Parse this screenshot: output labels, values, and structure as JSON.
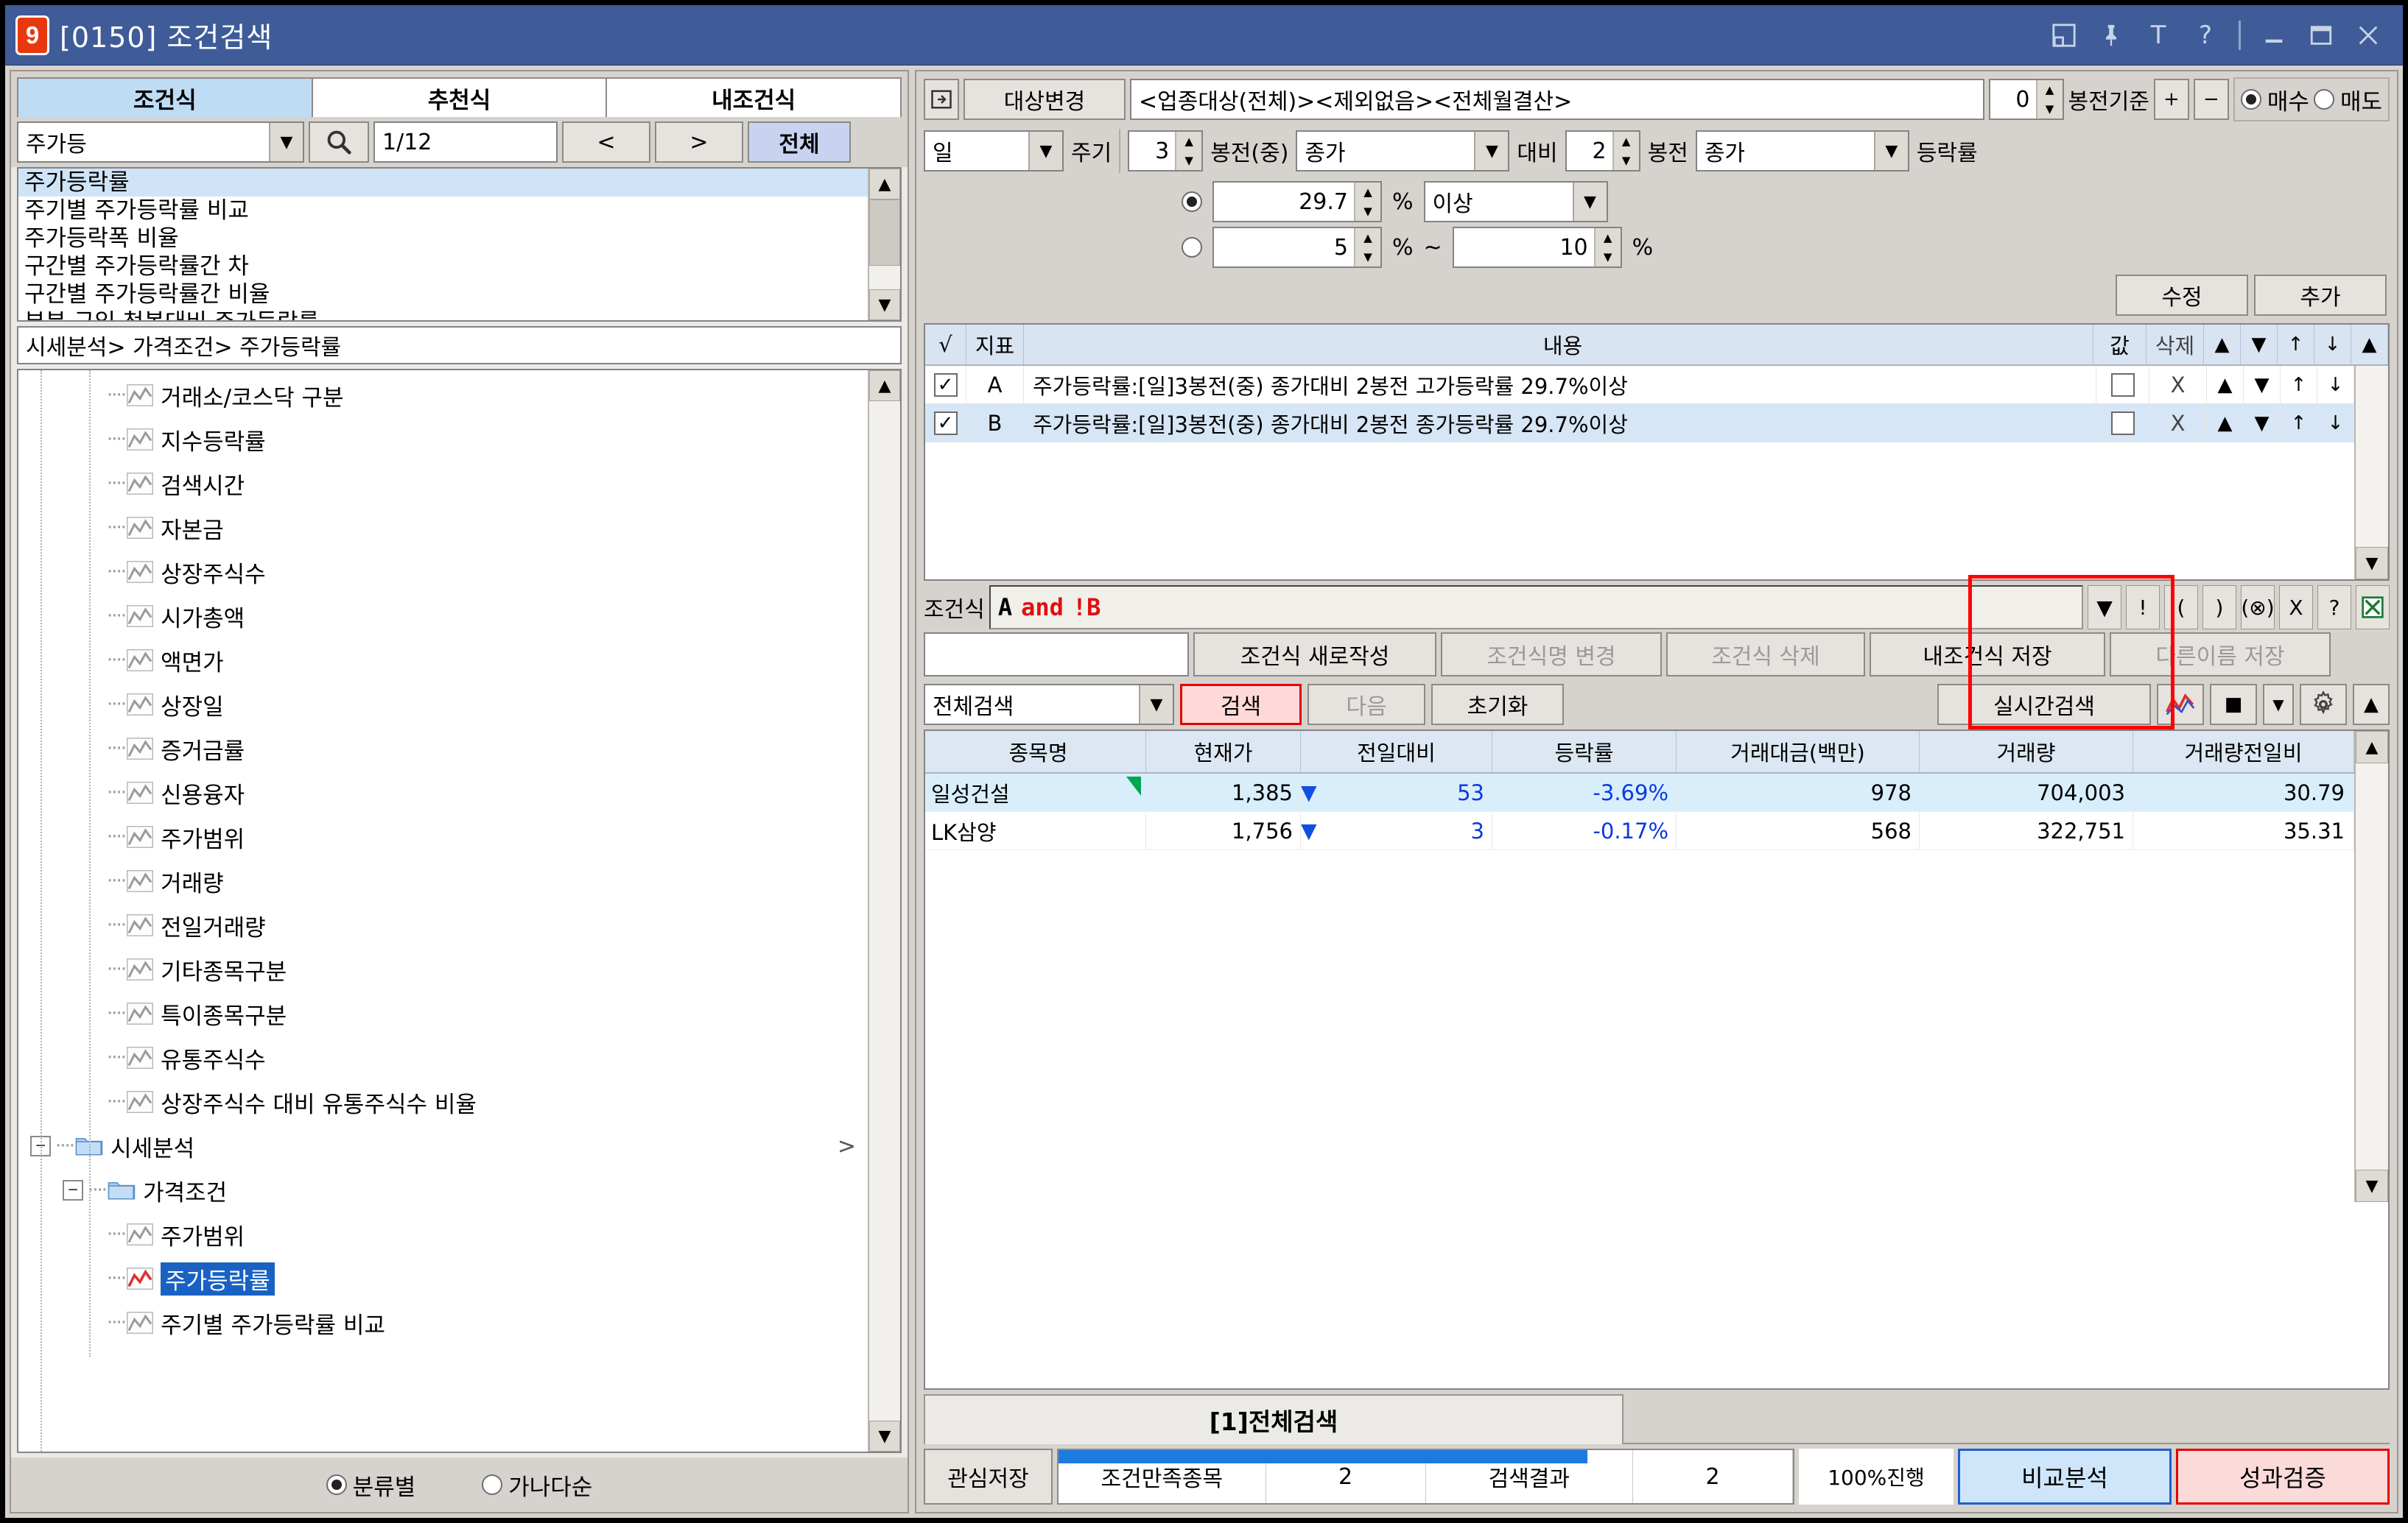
{
  "window": {
    "badge": "9",
    "title": "[0150] 조건검색",
    "icons": [
      "restore-icon",
      "pin-icon",
      "text-icon",
      "help-icon",
      "minimize-icon",
      "maximize-icon",
      "close-icon"
    ]
  },
  "left": {
    "tabs": [
      {
        "label": "조건식",
        "active": true
      },
      {
        "label": "추천식",
        "active": false
      },
      {
        "label": "내조건식",
        "active": false
      }
    ],
    "search": {
      "category": "주가등",
      "search_icon": "magnifier-icon",
      "page": "1/12",
      "prev": "<",
      "next": ">",
      "all": "전체"
    },
    "list": [
      {
        "label": "주가등락률",
        "selected": true
      },
      {
        "label": "주기별 주가등락률 비교",
        "selected": false
      },
      {
        "label": "주가등락폭 비율",
        "selected": false
      },
      {
        "label": "구간별 주가등락률간 차",
        "selected": false
      },
      {
        "label": "구간별 주가등락률간 비율",
        "selected": false
      },
      {
        "label": "부분 구입 첫봉대비 주가등락률",
        "selected": false
      }
    ],
    "breadcrumb": "시세분석> 가격조건> 주가등락률",
    "tree": [
      {
        "label": "거래소/코스닥 구분",
        "type": "leaf",
        "depth": 2
      },
      {
        "label": "지수등락률",
        "type": "leaf",
        "depth": 2
      },
      {
        "label": "검색시간",
        "type": "leaf",
        "depth": 2
      },
      {
        "label": "자본금",
        "type": "leaf",
        "depth": 2
      },
      {
        "label": "상장주식수",
        "type": "leaf",
        "depth": 2
      },
      {
        "label": "시가총액",
        "type": "leaf",
        "depth": 2
      },
      {
        "label": "액면가",
        "type": "leaf",
        "depth": 2
      },
      {
        "label": "상장일",
        "type": "leaf",
        "depth": 2
      },
      {
        "label": "증거금률",
        "type": "leaf",
        "depth": 2
      },
      {
        "label": "신용융자",
        "type": "leaf",
        "depth": 2
      },
      {
        "label": "주가범위",
        "type": "leaf",
        "depth": 2
      },
      {
        "label": "거래량",
        "type": "leaf",
        "depth": 2
      },
      {
        "label": "전일거래량",
        "type": "leaf",
        "depth": 2
      },
      {
        "label": "기타종목구분",
        "type": "leaf",
        "depth": 2
      },
      {
        "label": "특이종목구분",
        "type": "leaf",
        "depth": 2
      },
      {
        "label": "유통주식수",
        "type": "leaf",
        "depth": 2
      },
      {
        "label": "상장주식수 대비 유통주식수 비율",
        "type": "leaf",
        "depth": 2
      },
      {
        "label": "시세분석",
        "type": "folder",
        "depth": 0,
        "expander": "−",
        "chevron": ">"
      },
      {
        "label": "가격조건",
        "type": "folder",
        "depth": 1,
        "expander": "−"
      },
      {
        "label": "주가범위",
        "type": "leaf",
        "depth": 2
      },
      {
        "label": "주가등락률",
        "type": "leaf-sel",
        "depth": 2
      },
      {
        "label": "주기별 주가등락률 비교",
        "type": "leaf",
        "depth": 2
      }
    ],
    "sort": {
      "by_category": "분류별",
      "by_alphabet": "가나다순",
      "selected": "분류별"
    }
  },
  "right": {
    "target_bar": {
      "expand_icon": "panel-expand-icon",
      "change_button": "대상변경",
      "target_value": "<업종대상(전체)><제외없음><전체월결산>",
      "spin_value": "0",
      "bar_basis": "봉전기준",
      "plus": "+",
      "minus": "−",
      "buy": "매수",
      "sell": "매도",
      "side_selected": "매수"
    },
    "condition_row": {
      "period": "일",
      "period_label": "주기",
      "bars_before": "3",
      "bars_before_label": "봉전(중)",
      "price_type_1": "종가",
      "vs_label": "대비",
      "bars_before_2": "2",
      "bars_before_2_label": "봉전",
      "price_type_2": "종가",
      "rate_label": "등락률"
    },
    "value_rows": {
      "row1_selected": true,
      "row1_value": "29.7",
      "row1_pct": "%",
      "row1_compare": "이상",
      "row2_selected": false,
      "row2_from": "5",
      "row2_pct": "%",
      "row2_tilde": "~",
      "row2_to": "10",
      "row2_pct2": "%"
    },
    "action_buttons": {
      "modify": "수정",
      "add": "추가"
    },
    "conditions_table": {
      "headers": {
        "check": "√",
        "index": "지표",
        "content": "내용",
        "value": "값",
        "delete": "삭제",
        "up_bold": "▲",
        "down_bold": "▼",
        "up": "↑",
        "down": "↓"
      },
      "rows": [
        {
          "checked": true,
          "index": "A",
          "content": "주가등락률:[일]3봉전(중) 종가대비 2봉전 고가등락률 29.7%이상",
          "value": "",
          "delete": "X",
          "up_bold": "▲",
          "down_bold": "▼",
          "up": "↑",
          "down": "↓"
        },
        {
          "checked": true,
          "index": "B",
          "content": "주가등락률:[일]3봉전(중) 종가대비 2봉전 종가등락률 29.7%이상",
          "value": "",
          "delete": "X",
          "up_bold": "▲",
          "down_bold": "▼",
          "up": "↑",
          "down": "↓"
        }
      ]
    },
    "formula": {
      "label": "조건식",
      "value": "A and !B",
      "value_a": "A",
      "value_op": "and",
      "value_b": "!B",
      "mini_buttons": [
        "▼",
        "!",
        "(",
        ")",
        "(⊗)",
        "X",
        "?",
        "excel-icon"
      ]
    },
    "formula_buttons": {
      "name_field": "",
      "new": "조건식 새로작성",
      "rename": "조건식명 변경",
      "delete": "조건식 삭제",
      "save": "내조건식 저장",
      "save_as": "다른이름 저장"
    },
    "search_toolbar": {
      "scope": "전체검색",
      "search": "검색",
      "next": "다음",
      "reset": "초기화",
      "realtime": "실시간검색",
      "chart_icon": "chart-icon",
      "stop_icon": "■",
      "drop_icon": "▼",
      "gear_icon": "gear-icon",
      "up_icon": "▲"
    },
    "results_table": {
      "headers": [
        "종목명",
        "현재가",
        "전일대비",
        "등락률",
        "거래대금(백만)",
        "거래량",
        "거래량전일비"
      ],
      "rows": [
        {
          "name": "일성건설",
          "price": "1,385",
          "arrow": "▼",
          "diff": "53",
          "rate": "-3.69%",
          "amount": "978",
          "volume": "704,003",
          "prev_ratio": "30.79",
          "highlight": true,
          "flag": "green"
        },
        {
          "name": "LK삼양",
          "price": "1,756",
          "arrow": "▼",
          "diff": "3",
          "rate": "-0.17%",
          "amount": "568",
          "volume": "322,751",
          "prev_ratio": "35.31",
          "highlight": false,
          "flag": ""
        }
      ]
    },
    "bottom_tab": "[1]전체검색",
    "status": {
      "save_watchlist": "관심저장",
      "match_label": "조건만족종목",
      "match_count": "2",
      "result_label": "검색결과",
      "result_count": "2",
      "progress": "100%진행",
      "compare": "비교분석",
      "verify": "성과검증"
    }
  }
}
